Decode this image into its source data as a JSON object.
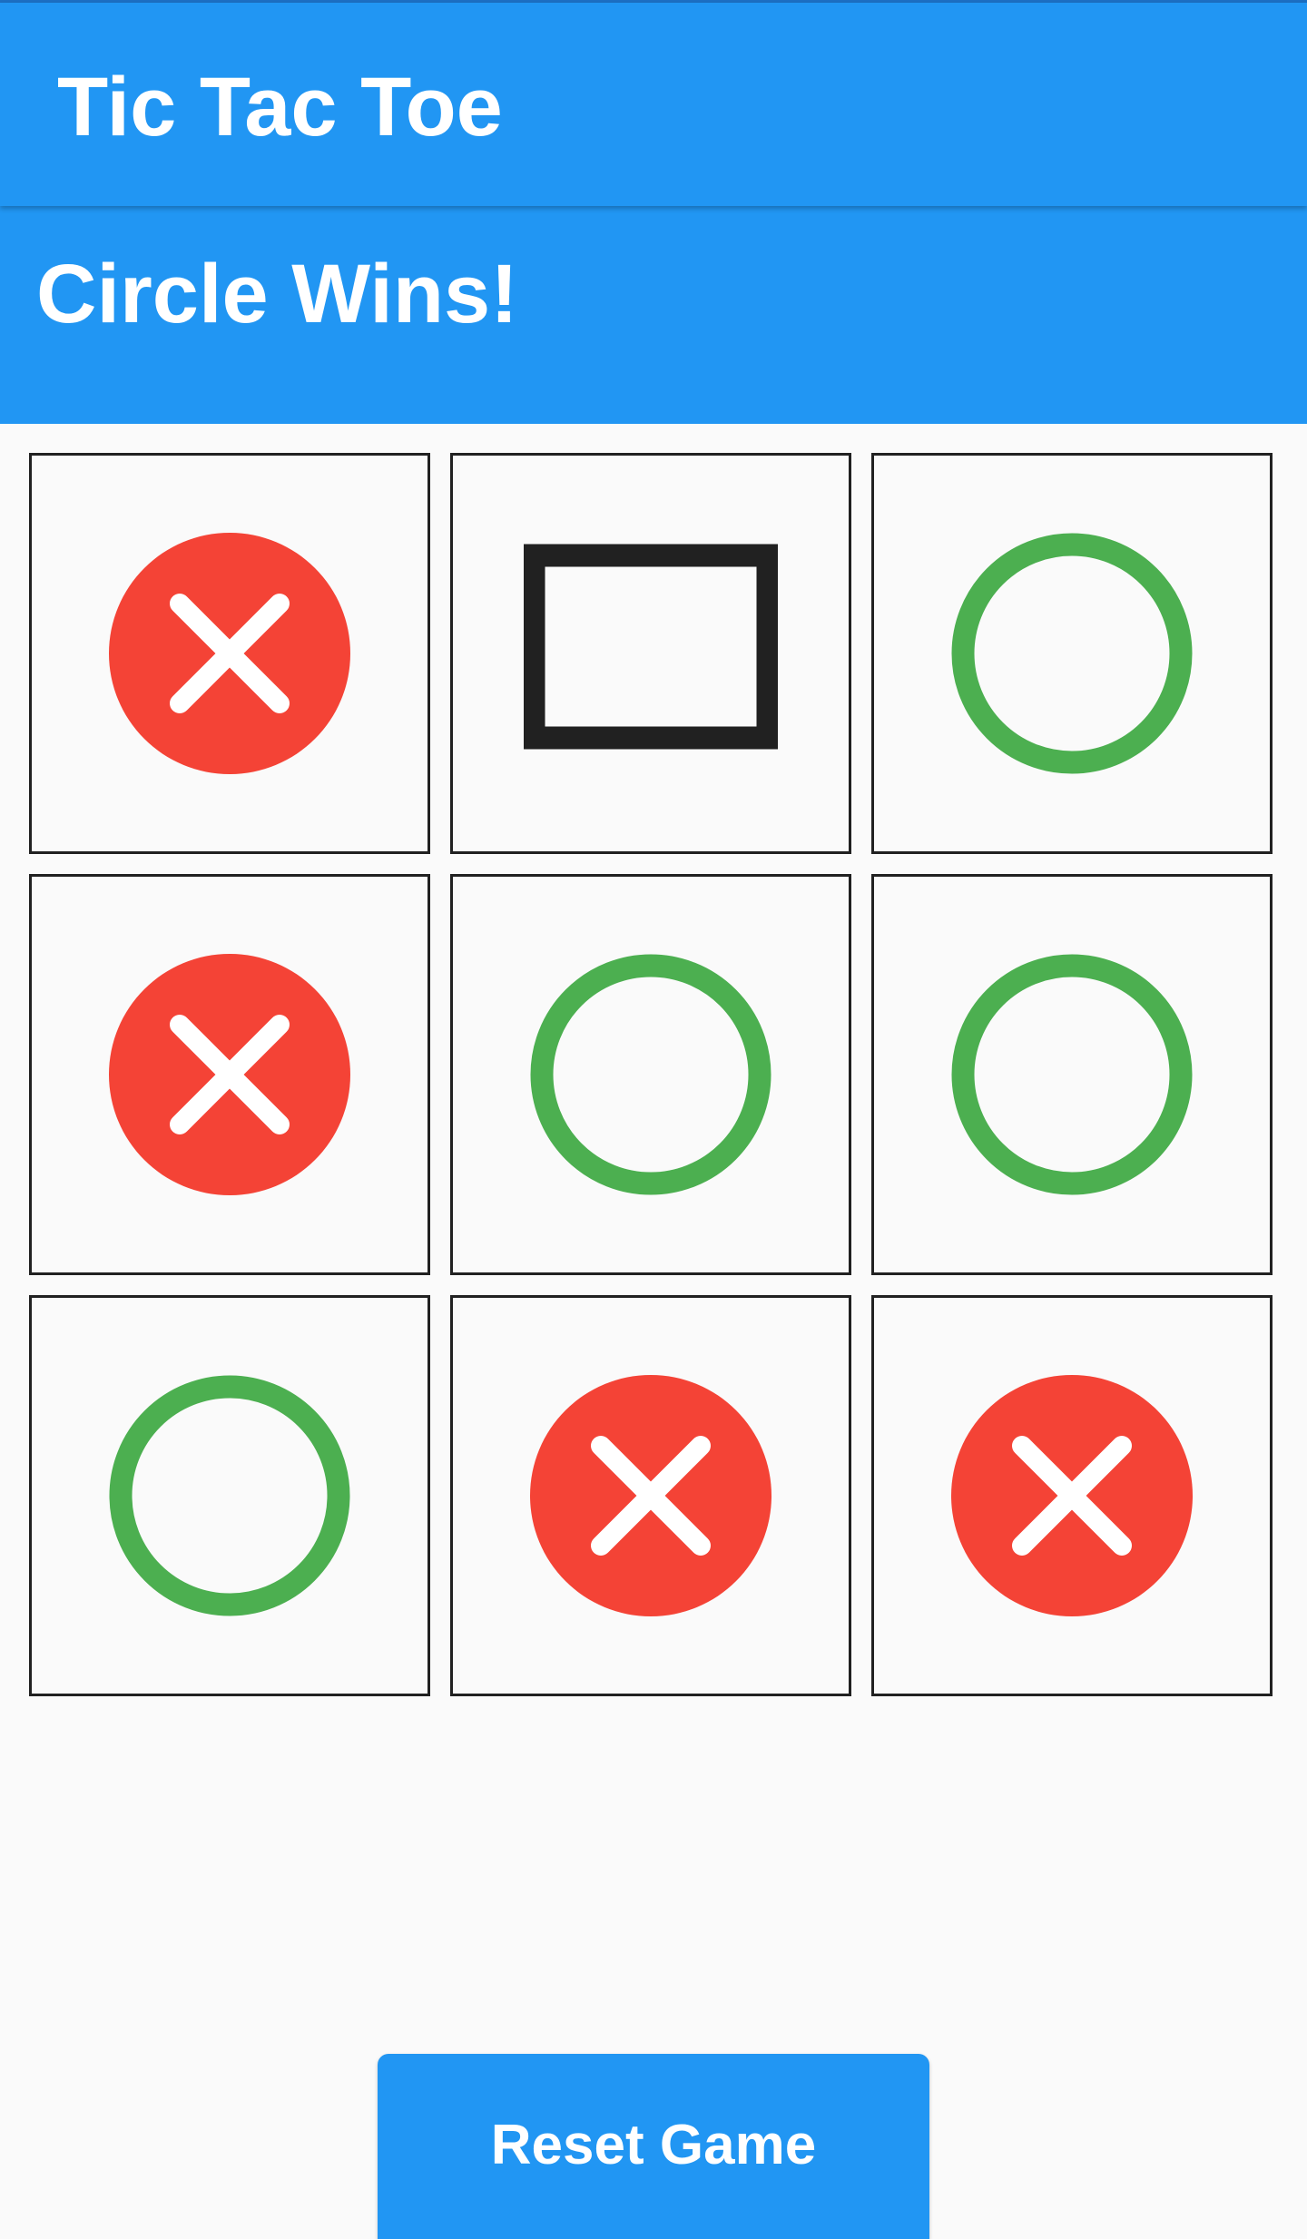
{
  "app": {
    "title": "Tic Tac Toe"
  },
  "status": {
    "text": "Circle Wins!"
  },
  "board": {
    "cells": [
      {
        "mark": "cross",
        "icon": "cross-in-circle-icon"
      },
      {
        "mark": "empty",
        "icon": "square-outline-icon"
      },
      {
        "mark": "circle",
        "icon": "circle-outline-icon"
      },
      {
        "mark": "cross",
        "icon": "cross-in-circle-icon"
      },
      {
        "mark": "circle",
        "icon": "circle-outline-icon"
      },
      {
        "mark": "circle",
        "icon": "circle-outline-icon"
      },
      {
        "mark": "circle",
        "icon": "circle-outline-icon"
      },
      {
        "mark": "cross",
        "icon": "cross-in-circle-icon"
      },
      {
        "mark": "cross",
        "icon": "cross-in-circle-icon"
      }
    ]
  },
  "reset": {
    "label": "Reset Game"
  },
  "colors": {
    "primary": "#2196f3",
    "cross": "#f44336",
    "circle": "#4caf50",
    "empty": "#212121",
    "cell_border": "#212121",
    "background": "#fafafa",
    "text_on_primary": "#ffffff"
  }
}
